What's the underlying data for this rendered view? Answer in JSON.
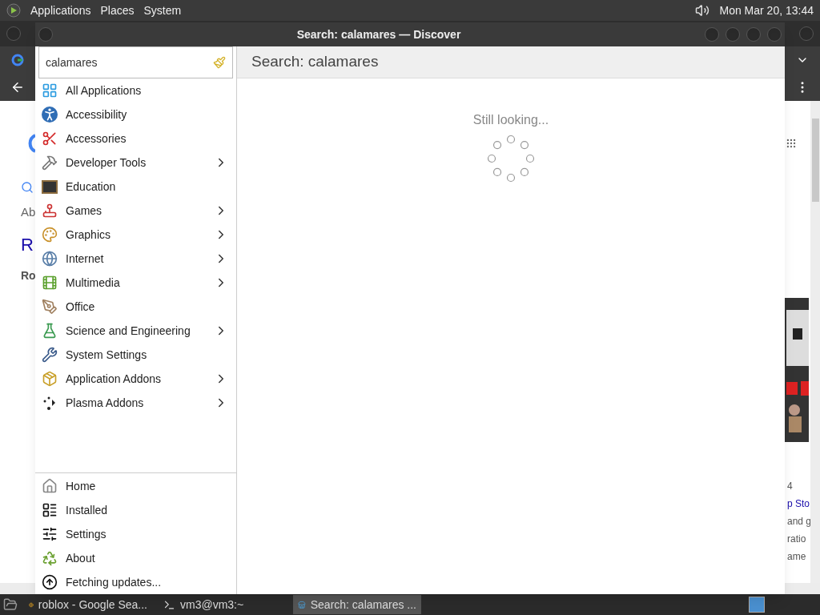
{
  "top_panel": {
    "menus": [
      "Applications",
      "Places",
      "System"
    ],
    "clock": "Mon Mar 20, 13:44"
  },
  "background_browser": {
    "left_texts": [
      {
        "kind": "plain",
        "text": "Ab"
      },
      {
        "kind": "heading",
        "text": "R"
      },
      {
        "kind": "bold",
        "text": "Ro"
      }
    ],
    "right_texts": [
      {
        "kind": "plain",
        "text": "4"
      },
      {
        "kind": "link",
        "text": "p Sto"
      },
      {
        "kind": "plain",
        "text": "and g"
      },
      {
        "kind": "plain",
        "text": "ratio"
      },
      {
        "kind": "plain",
        "text": "ame"
      }
    ]
  },
  "window": {
    "title": "Search: calamares — Discover"
  },
  "search": {
    "value": "calamares"
  },
  "categories": [
    {
      "label": "All Applications",
      "has_submenu": false,
      "selected": false
    },
    {
      "label": "Accessibility",
      "has_submenu": false,
      "selected": false
    },
    {
      "label": "Accessories",
      "has_submenu": false,
      "selected": false
    },
    {
      "label": "Developer Tools",
      "has_submenu": true,
      "selected": false
    },
    {
      "label": "Education",
      "has_submenu": false,
      "selected": false
    },
    {
      "label": "Games",
      "has_submenu": true,
      "selected": false
    },
    {
      "label": "Graphics",
      "has_submenu": true,
      "selected": false
    },
    {
      "label": "Internet",
      "has_submenu": true,
      "selected": false
    },
    {
      "label": "Multimedia",
      "has_submenu": true,
      "selected": false
    },
    {
      "label": "Office",
      "has_submenu": false,
      "selected": false
    },
    {
      "label": "Science and Engineering",
      "has_submenu": true,
      "selected": false
    },
    {
      "label": "System Settings",
      "has_submenu": false,
      "selected": false
    },
    {
      "label": "Application Addons",
      "has_submenu": true,
      "selected": false
    },
    {
      "label": "Plasma Addons",
      "has_submenu": true,
      "selected": false
    }
  ],
  "nav": [
    {
      "label": "Home",
      "selected": false
    },
    {
      "label": "Installed",
      "selected": false
    },
    {
      "label": "Settings",
      "selected": false
    },
    {
      "label": "About",
      "selected": false
    },
    {
      "label": "Fetching updates...",
      "selected": false
    }
  ],
  "main": {
    "header": "Search: calamares",
    "status": "Still looking..."
  },
  "taskbar": {
    "items": [
      {
        "label": "roblox - Google Sea...",
        "kind": "browser",
        "selected": false
      },
      {
        "label": "vm3@vm3:~",
        "kind": "terminal",
        "selected": false
      },
      {
        "label": "Search: calamares ...",
        "kind": "discover",
        "selected": true
      }
    ]
  }
}
